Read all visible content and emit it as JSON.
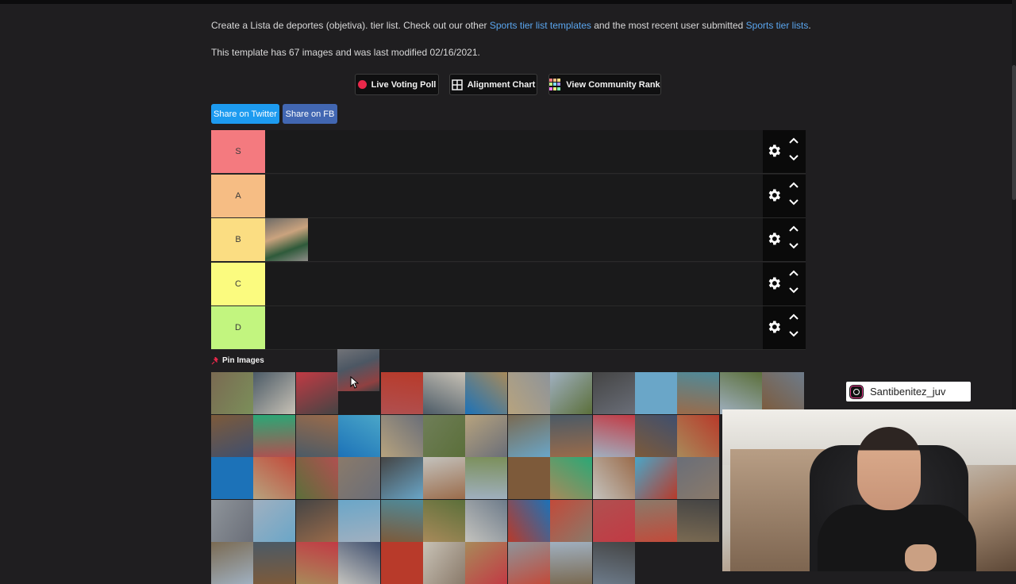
{
  "description": {
    "before": "Create a Lista de deportes (objetiva). tier list. Check out our other ",
    "link1": "Sports tier list templates",
    "middle": " and the most recent user submitted ",
    "link2": "Sports tier lists",
    "after": "."
  },
  "info": "This template has 67 images and was last modified 02/16/2021.",
  "toolbar": {
    "live_voting": "Live Voting Poll",
    "alignment_chart": "Alignment Chart",
    "community_rank": "View Community Rank"
  },
  "share": {
    "twitter": "Share on Twitter",
    "facebook": "Share on FB"
  },
  "tiers": [
    {
      "label": "S",
      "color": "#f47a7f"
    },
    {
      "label": "A",
      "color": "#f6bd84"
    },
    {
      "label": "B",
      "color": "#fbdd82"
    },
    {
      "label": "C",
      "color": "#fbfb7f"
    },
    {
      "label": "D",
      "color": "#c2f57f"
    }
  ],
  "tier_b_item": "mma-fighter-image",
  "pin_images": "Pin Images",
  "instagram_handle": "Santibenitez_juv",
  "pool_images": [
    [
      "soldiers",
      "chess",
      "hang-gliding",
      "",
      "running-shoes",
      "badminton",
      "handball",
      "basketball-hoop",
      "rugby",
      "baseball",
      "billiards",
      "police",
      "bowling",
      "boxing"
    ],
    [
      "scuba-diving",
      "camping",
      "kayak",
      "canoe",
      "camels",
      "motorsport",
      "motorcycle",
      "skydiving",
      "military",
      "falconry",
      "cycling",
      "horse-riding",
      "",
      ""
    ],
    [
      "cricket",
      "bodybuilding",
      "esports",
      "horse-racing",
      "snowboard",
      "fencing",
      "american-football",
      "soccer",
      "golf",
      "hockey",
      "athletics",
      "javelin",
      "",
      ""
    ],
    [
      "marathon",
      "synchronized-swimming",
      "surfing",
      "climbing",
      "hunting",
      "diving",
      "inline-skating",
      "beach-tennis",
      "tai-chi",
      "archery",
      "table-tennis",
      "rowing",
      "",
      ""
    ],
    [
      "frisbee",
      "gymnastics",
      "aerobics",
      "parkour",
      "sumo",
      "surfing-wave",
      "skateboard",
      "shooting",
      "volleyball",
      "water-polo",
      "",
      "",
      "",
      ""
    ]
  ]
}
